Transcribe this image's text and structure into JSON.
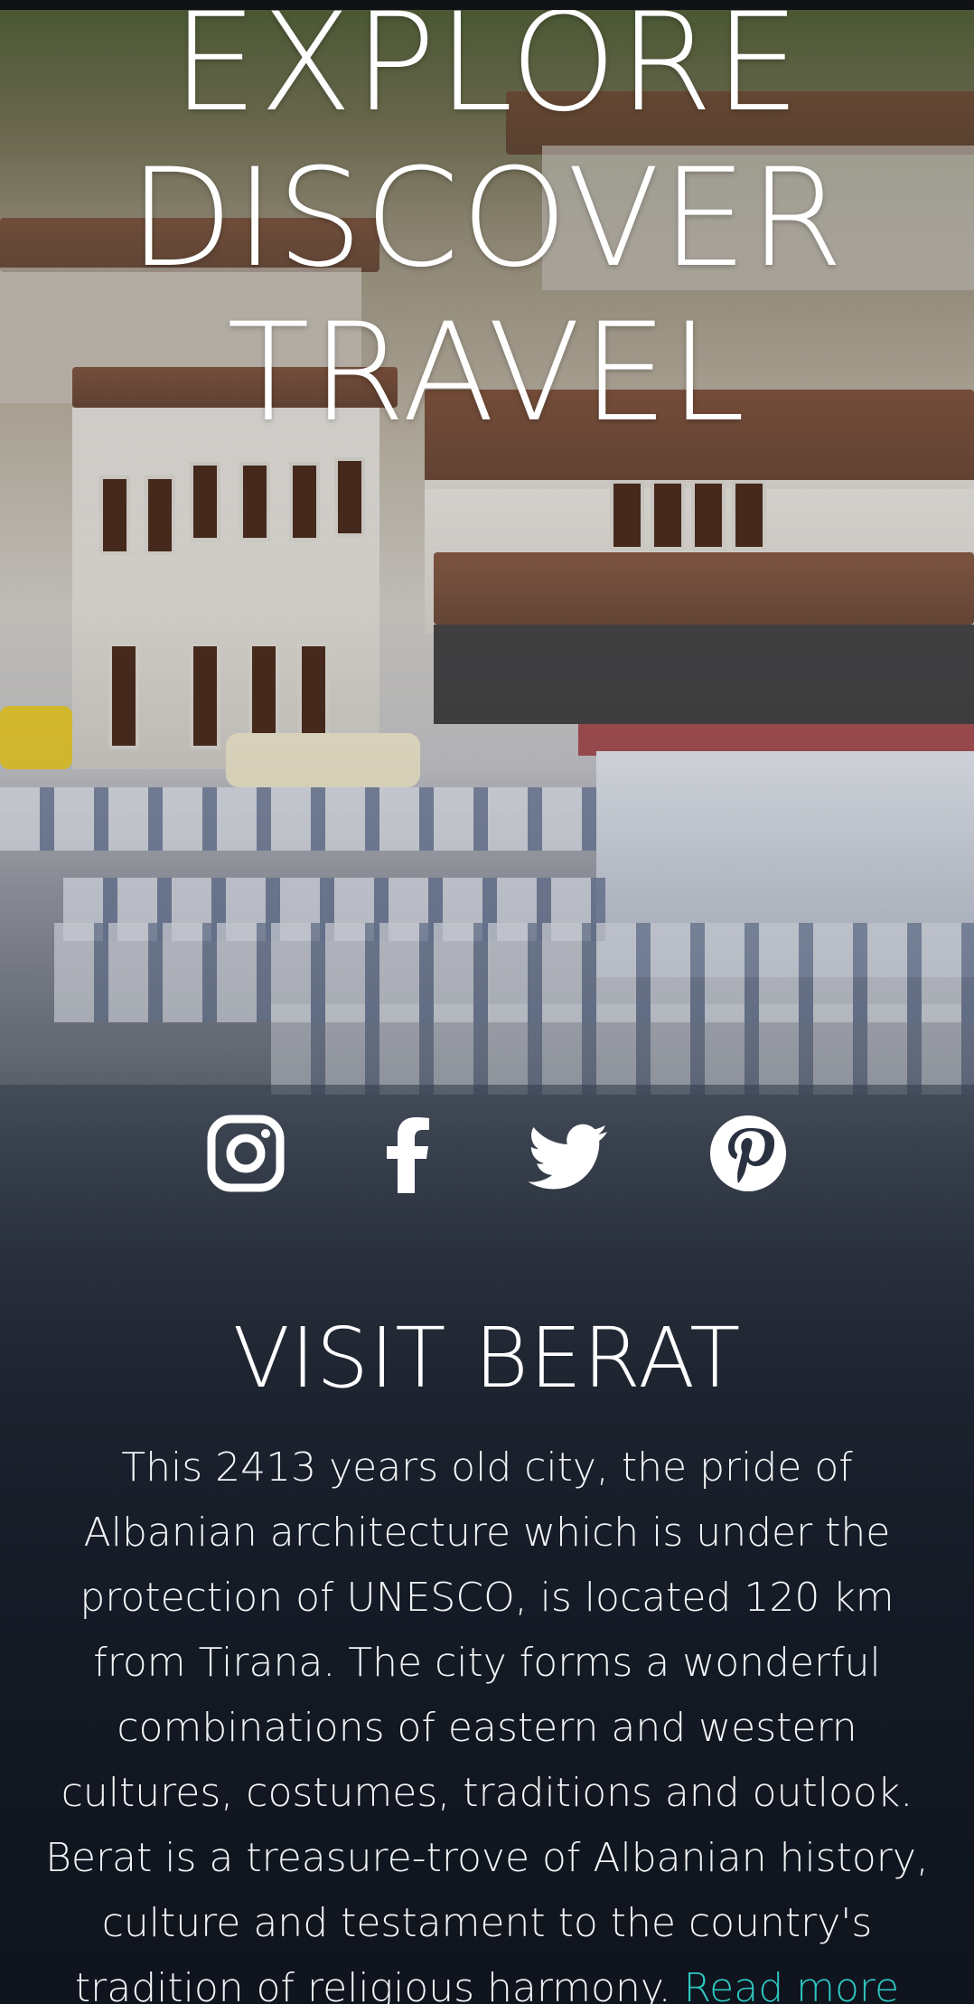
{
  "hero": {
    "headline_lines": [
      "EXPLORE",
      "DISCOVER",
      "TRAVEL"
    ]
  },
  "social": {
    "items": [
      {
        "name": "instagram",
        "icon": "instagram-icon"
      },
      {
        "name": "facebook",
        "icon": "facebook-icon"
      },
      {
        "name": "twitter",
        "icon": "twitter-icon"
      },
      {
        "name": "pinterest",
        "icon": "pinterest-icon"
      }
    ]
  },
  "section": {
    "title": "VISIT BERAT",
    "body": "This 2413 years old city, the pride of Albanian architecture which is under the protection of UNESCO, is located 120 km from Tirana. The city forms a wonderful combinations of eastern and western cultures, costumes, traditions and outlook. Berat is a treasure-trove of Albanian history, culture and testament to the country's tradition of religious harmony. ",
    "read_more": "Read more"
  },
  "colors": {
    "text": "#ffffff",
    "link": "#2fc6c0",
    "status_bar": "#101216"
  }
}
